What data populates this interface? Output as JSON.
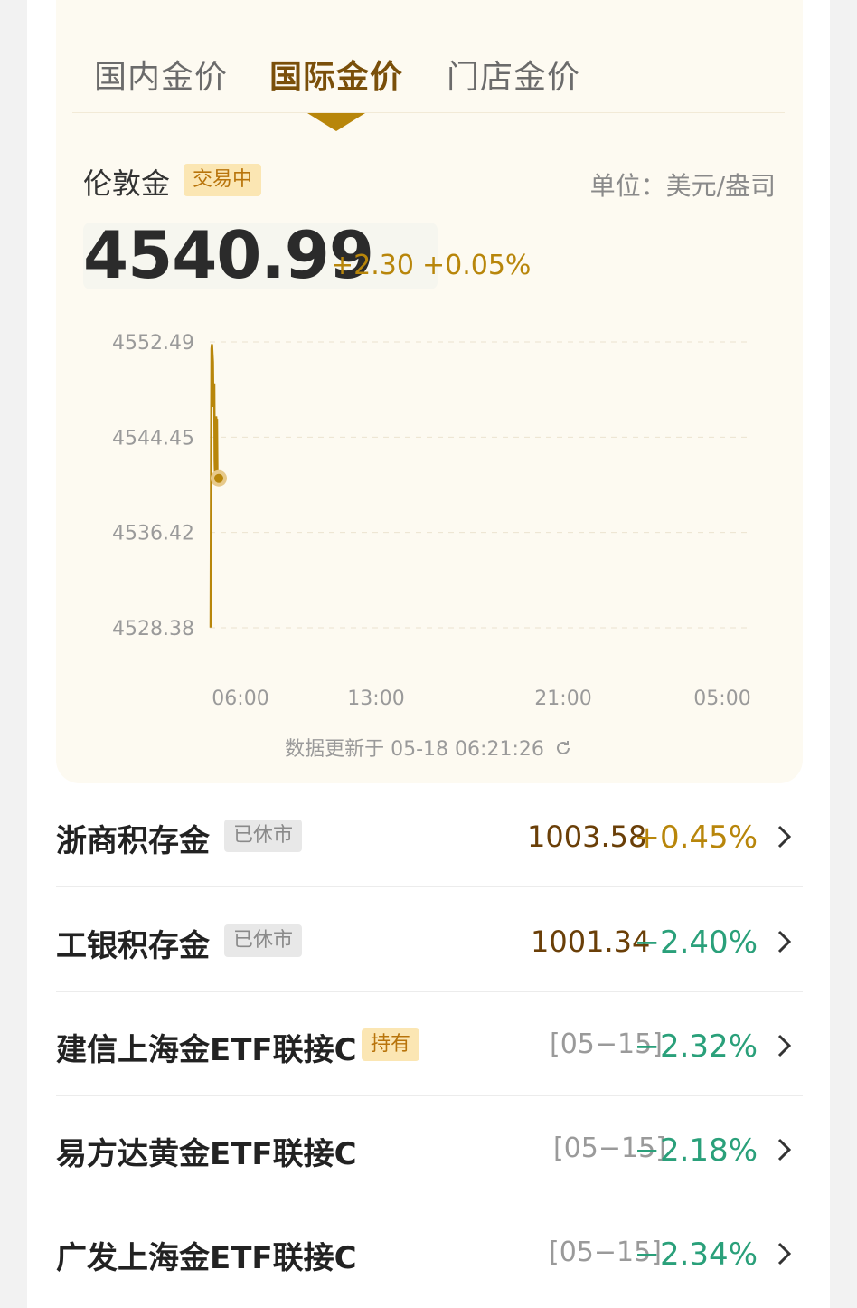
{
  "tabs": [
    {
      "label": "国内金价",
      "active": false
    },
    {
      "label": "国际金价",
      "active": true
    },
    {
      "label": "门店金价",
      "active": false
    }
  ],
  "instrument": {
    "name": "伦敦金",
    "status": "交易中",
    "unit": "单位：美元/盎司",
    "price": "4540.99",
    "change_abs": "+2.30",
    "change_pct": "+0.05%"
  },
  "chart_data": {
    "type": "line",
    "x_ticks": [
      "06:00",
      "13:00",
      "21:00",
      "05:00"
    ],
    "y_ticks": [
      "4552.49",
      "4544.45",
      "4536.42",
      "4528.38"
    ],
    "ylim": [
      4528.38,
      4552.49
    ],
    "series": [
      {
        "x": [
          "05:50",
          "05:51",
          "05:52",
          "05:53",
          "05:54",
          "05:55",
          "05:56",
          "05:57",
          "05:58",
          "05:59",
          "06:00",
          "06:01",
          "06:02",
          "06:03",
          "06:04",
          "06:05",
          "06:06"
        ],
        "values": [
          4528.4,
          4541.0,
          4551.9,
          4552.3,
          4551.5,
          4550.8,
          4547.0,
          4548.2,
          4549.0,
          4542.5,
          4540.99,
          4541.3,
          4546.2,
          4545.8,
          4546.0,
          4541.0,
          4540.99
        ]
      }
    ],
    "current_point": {
      "x": "06:06",
      "value": 4540.99
    },
    "grid": true,
    "line_color": "#b8860b"
  },
  "update_text": "数据更新于 05-18 06:21:26",
  "refresh_icon": "refresh-icon",
  "products": [
    {
      "name": "浙商积存金",
      "tag": "已休市",
      "tag_type": "closed",
      "value": "1003.58",
      "date": "",
      "pct": "+0.45%",
      "direction": "up"
    },
    {
      "name": "工银积存金",
      "tag": "已休市",
      "tag_type": "closed",
      "value": "1001.34",
      "date": "",
      "pct": "−2.40%",
      "direction": "down"
    },
    {
      "name": "建信上海金ETF联接C",
      "tag": "持有",
      "tag_type": "holding",
      "value": "",
      "date": "[05−15]",
      "pct": "−2.32%",
      "direction": "down"
    },
    {
      "name": "易方达黄金ETF联接C",
      "tag": "",
      "tag_type": "",
      "value": "",
      "date": "[05−15]",
      "pct": "−2.18%",
      "direction": "down"
    },
    {
      "name": "广发上海金ETF联接C",
      "tag": "",
      "tag_type": "",
      "value": "",
      "date": "[05−15]",
      "pct": "−2.34%",
      "direction": "down"
    }
  ],
  "colors": {
    "accent": "#b8860b",
    "up": "#b8860b",
    "down": "#2aa07a",
    "card_bg": "#fdfaf1"
  }
}
